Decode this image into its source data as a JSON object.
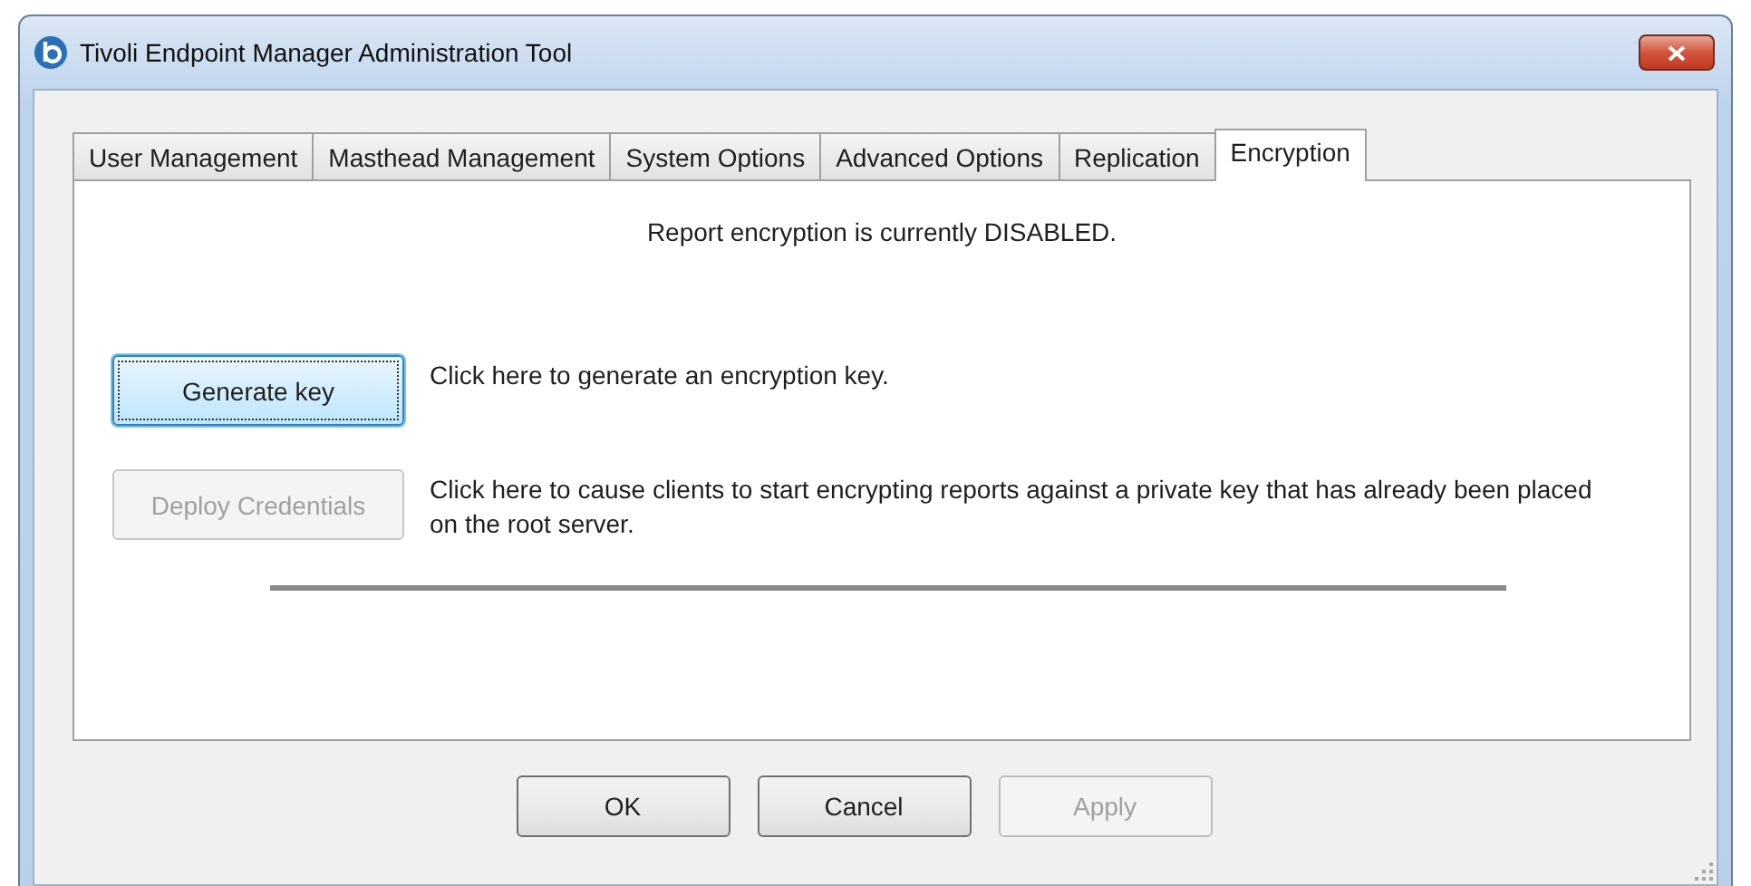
{
  "window": {
    "title": "Tivoli Endpoint Manager Administration Tool"
  },
  "tabs": [
    {
      "label": "User Management",
      "selected": false
    },
    {
      "label": "Masthead Management",
      "selected": false
    },
    {
      "label": "System Options",
      "selected": false
    },
    {
      "label": "Advanced Options",
      "selected": false
    },
    {
      "label": "Replication",
      "selected": false
    },
    {
      "label": "Encryption",
      "selected": true
    }
  ],
  "status_text": "Report encryption is currently DISABLED.",
  "actions": [
    {
      "button": "Generate key",
      "description": "Click here to generate an encryption key.",
      "disabled": false,
      "focused": true
    },
    {
      "button": "Deploy Credentials",
      "description": "Click here to cause clients to start encrypting reports against a private key that has already been placed on the root server.",
      "disabled": true,
      "focused": false
    }
  ],
  "buttons": [
    {
      "label": "OK",
      "disabled": false
    },
    {
      "label": "Cancel",
      "disabled": false
    },
    {
      "label": "Apply",
      "disabled": true
    }
  ]
}
